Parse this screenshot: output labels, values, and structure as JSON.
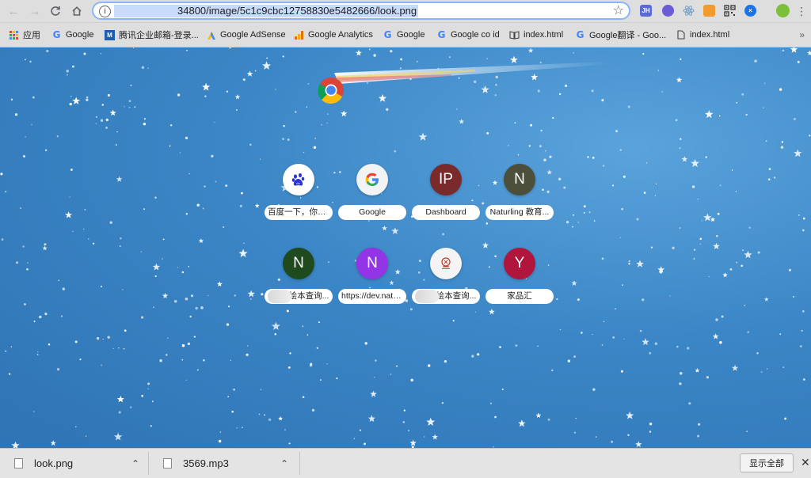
{
  "toolbar": {
    "back_icon": "arrow-left-icon",
    "forward_icon": "arrow-right-icon",
    "reload_icon": "reload-icon",
    "home_icon": "home-icon",
    "url": "34800/image/5c1c9cbc12758830e5482666/look.png",
    "extensions": [
      "JH",
      "",
      "",
      "",
      "",
      "",
      ""
    ]
  },
  "bookmarks": [
    {
      "label": "应用",
      "icon": "apps-grid-icon"
    },
    {
      "label": "Google",
      "icon": "google-icon"
    },
    {
      "label": "腾讯企业邮箱-登录...",
      "icon": "tencent-mail-icon"
    },
    {
      "label": "Google AdSense",
      "icon": "adsense-icon"
    },
    {
      "label": "Google Analytics",
      "icon": "analytics-icon"
    },
    {
      "label": "Google",
      "icon": "google-icon"
    },
    {
      "label": "Google co id",
      "icon": "google-icon"
    },
    {
      "label": "index.html",
      "icon": "book-icon"
    },
    {
      "label": "Google翻译 - Goo...",
      "icon": "google-icon"
    },
    {
      "label": "index.html",
      "icon": "document-icon"
    }
  ],
  "shortcuts": [
    {
      "label": "百度一下，你就...",
      "letter": "",
      "icon": "baidu-icon",
      "color": "#ffffff"
    },
    {
      "label": "Google",
      "letter": "",
      "icon": "google-icon",
      "color": "#f1f3f4"
    },
    {
      "label": "Dashboard",
      "letter": "IP",
      "icon": "",
      "color": "#7a2a2a"
    },
    {
      "label": "Naturling 教育...",
      "letter": "N",
      "icon": "",
      "color": "#4c4f39"
    },
    {
      "label": "绘本查询...",
      "letter": "N",
      "icon": "",
      "color": "#1f4a1e"
    },
    {
      "label": "https://dev.natu...",
      "letter": "N",
      "icon": "",
      "color": "#9334e6"
    },
    {
      "label": "绘本查询...",
      "letter": "",
      "icon": "site-logo-icon",
      "color": "#f4f4f4"
    },
    {
      "label": "家品汇",
      "letter": "Y",
      "icon": "",
      "color": "#b0153c"
    }
  ],
  "downloads": [
    {
      "name": "look.png"
    },
    {
      "name": "3569.mp3"
    }
  ],
  "show_all_label": "显示全部"
}
